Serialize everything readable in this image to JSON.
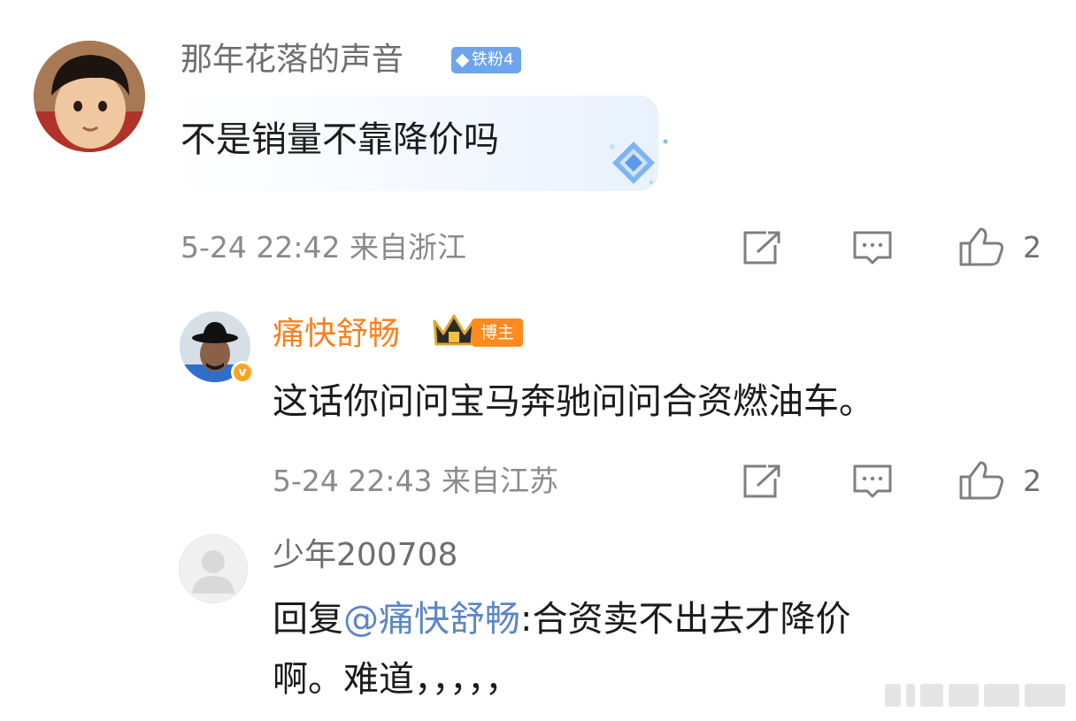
{
  "comment": {
    "username": "那年花落的声音",
    "fan_badge": "铁粉4",
    "text": "不是销量不靠降价吗",
    "time": "5-24 22:42",
    "location": "来自浙江",
    "likes": "2"
  },
  "reply": {
    "username": "痛快舒畅",
    "role_badge": "博主",
    "verified_mark": "v",
    "text": "这话你问问宝马奔驰问问合资燃油车。",
    "time": "5-24 22:43",
    "location": "来自江苏",
    "likes": "2"
  },
  "reply2": {
    "username": "少年200708",
    "reply_prefix": "回复",
    "mention": "@痛快舒畅",
    "text_line1": ":合资卖不出去才降价",
    "text_line2": "啊。难道，，，，，"
  },
  "icons": [
    "share-icon",
    "comment-icon",
    "like-icon",
    "diamond-icon",
    "crown-icon"
  ],
  "colors": {
    "blogger_name": "#ff7f1c",
    "mention": "#5c85c5",
    "fan_badge": "#6ea4ee",
    "blogger_badge": "#ff8a1e"
  }
}
